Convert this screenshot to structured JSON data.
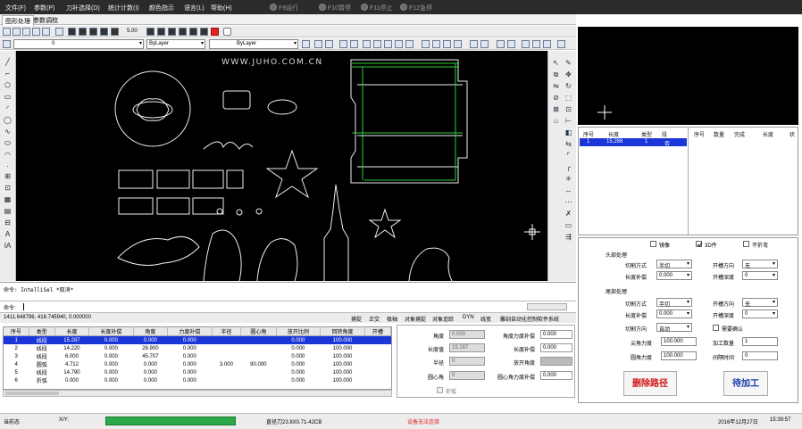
{
  "menu": {
    "items": [
      "文件(F)",
      "参数(P)",
      "刀补选择(D)",
      "统计计数(I)",
      "颜色指示",
      "语言(L)",
      "帮助(H)"
    ],
    "run_items": [
      "F9运行",
      "F10暂停",
      "F11停止",
      "F12急停"
    ]
  },
  "tabs": [
    "图形处理",
    "参数调校"
  ],
  "toolbar": {
    "zoom_value": "5.00",
    "layer_value": "0",
    "color_value": "ByLayer",
    "linetype_value": "ByLayer"
  },
  "canvas": {
    "watermark": "WWW.JUHO.COM.CN"
  },
  "command": {
    "history": "命令:  IntelliSel *取消*",
    "prompt": "命令:"
  },
  "status": {
    "coords": "1411.648796, 416.745940, 0.000000",
    "toggles": [
      "捕捉",
      "正交",
      "极轴",
      "对象捕捉",
      "对象追踪",
      "DYN",
      "线宽",
      "雕刻自动化控制软件系统"
    ]
  },
  "grid": {
    "columns": [
      "序号",
      "类型",
      "长度",
      "长度补偿",
      "角度",
      "力度补偿",
      "半径",
      "圆心角",
      "放开比例",
      "回转角度",
      "开槽"
    ],
    "rows": [
      [
        "1",
        "线段",
        "15.287",
        "0.000",
        "0.000",
        "0.000",
        "",
        "",
        "0.000",
        "100.000",
        ""
      ],
      [
        "2",
        "线段",
        "14.220",
        "0.000",
        "28.900",
        "0.000",
        "",
        "",
        "0.000",
        "100.000",
        ""
      ],
      [
        "3",
        "线段",
        "6.000",
        "0.000",
        "45.707",
        "0.000",
        "",
        "",
        "0.000",
        "100.000",
        ""
      ],
      [
        "4",
        "圆弧",
        "4.712",
        "0.000",
        "0.000",
        "0.000",
        "3.000",
        "90.000",
        "0.000",
        "100.000",
        ""
      ],
      [
        "5",
        "线段",
        "14.790",
        "0.000",
        "0.000",
        "0.000",
        "",
        "",
        "0.000",
        "100.000",
        ""
      ],
      [
        "6",
        "折弧",
        "0.000",
        "0.000",
        "0.000",
        "0.000",
        "",
        "",
        "0.000",
        "100.000",
        ""
      ]
    ],
    "selected_row": 0
  },
  "props": {
    "angle_label": "角度",
    "angle_value": "0.000",
    "angle_comp_label": "角度力度补偿",
    "angle_comp_value": "0.000",
    "length_label": "长度值",
    "length_value": "15.287",
    "length_comp_label": "长度补偿",
    "length_comp_value": "0.000",
    "radius_label": "半径",
    "radius_value": "0",
    "release_label": "放开角度",
    "center_label": "圆心角",
    "center_value": "0",
    "arc_comp_label": "圆心角力度补偿",
    "arc_comp_value": "0.000",
    "fold_label": "折弧"
  },
  "right_list": {
    "left_headers": [
      "序号",
      "长度",
      "类型",
      "段"
    ],
    "left_row": [
      "1",
      "15.286",
      "1",
      "否"
    ],
    "right_headers": [
      "序号",
      "数量",
      "完成",
      "长度",
      "状"
    ]
  },
  "controls": {
    "mirror_label": "镜像",
    "model3d_label": "3D件",
    "nofold_label": "不折弯",
    "head_section": "头部处理",
    "head_mode_label": "切割方式",
    "head_mode_value": "半切",
    "head_dir_label": "开槽方向",
    "head_dir_value": "无",
    "head_comp_label": "长度补偿",
    "head_comp_value": "0.000",
    "head_depth_label": "开槽深度",
    "head_depth_value": "0",
    "tail_section": "尾部处理",
    "tail_mode_label": "切割方式",
    "tail_mode_value": "半切",
    "tail_dir_label": "开槽方向",
    "tail_dir_value": "无",
    "tail_comp_label": "长度补偿",
    "tail_comp_value": "0.000",
    "tail_depth_label": "开槽深度",
    "tail_depth_value": "0",
    "cut_dir_label": "切割方向",
    "cut_dir_value": "自动",
    "need_confirm_label": "需要确认",
    "tip_force_label": "尖角力度",
    "tip_force_value": "100.000",
    "qty_label": "加工数量",
    "qty_value": "1",
    "arc_force_label": "圆角力度",
    "arc_force_value": "100.000",
    "interval_label": "间隔时间",
    "interval_value": "0",
    "delete_btn": "删除路径",
    "process_btn": "待加工"
  },
  "bottom": {
    "state": "当前态",
    "xy": "X/Y:",
    "tool_info": "直径刀23.8X0.71-42CB",
    "device": "设备无法连接",
    "date": "2016年12月27日",
    "time": "15:39:57"
  },
  "colors": {
    "canvas_bg": "#000000",
    "selection": "#1a35d8",
    "device_error": "#e02020",
    "delete_btn": "#d01818",
    "process_btn": "#1a3aa8",
    "progress": "#2ca84a"
  }
}
